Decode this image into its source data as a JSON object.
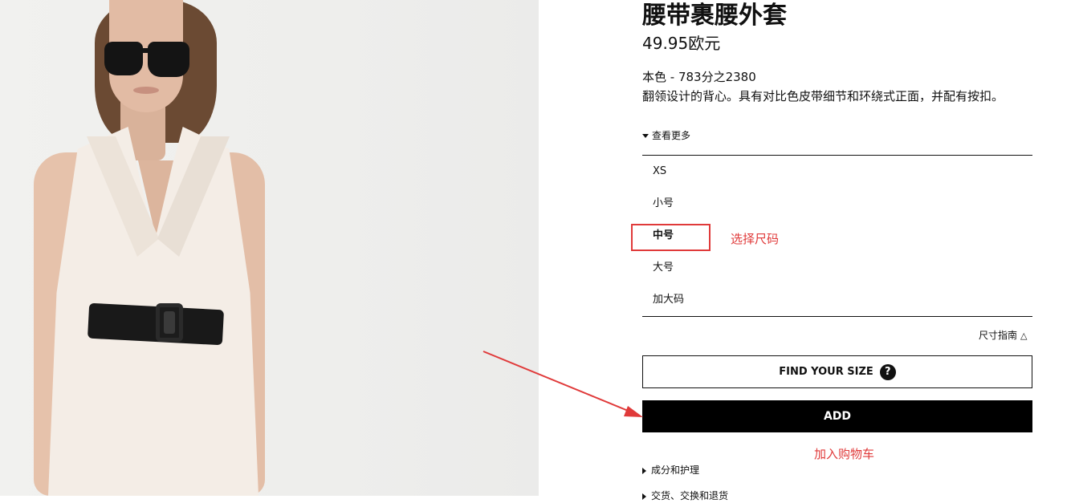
{
  "product": {
    "title": "腰带裹腰外套",
    "price": "49.95欧元",
    "color_ref": "本色 - 783分之2380",
    "description": "翻领设计的背心。具有对比色皮带细节和环绕式正面，并配有按扣。",
    "see_more": "查看更多"
  },
  "sizes": {
    "items": [
      "XS",
      "小号",
      "中号",
      "大号",
      "加大码"
    ],
    "selected": "中号"
  },
  "annotations": {
    "select_size": "选择尺码",
    "add_to_cart": "加入购物车",
    "color": "#e03a3a"
  },
  "size_guide": {
    "label": "尺寸指南",
    "icon": "hanger-icon"
  },
  "find_size": {
    "label": "FIND YOUR SIZE",
    "icon": "question-icon"
  },
  "add_button": {
    "label": "ADD"
  },
  "sections": [
    "成分和护理",
    "交货、交换和退货"
  ],
  "colors": {
    "button_bg": "#000000",
    "button_text": "#ffffff",
    "photo_bg": "#efefed"
  }
}
